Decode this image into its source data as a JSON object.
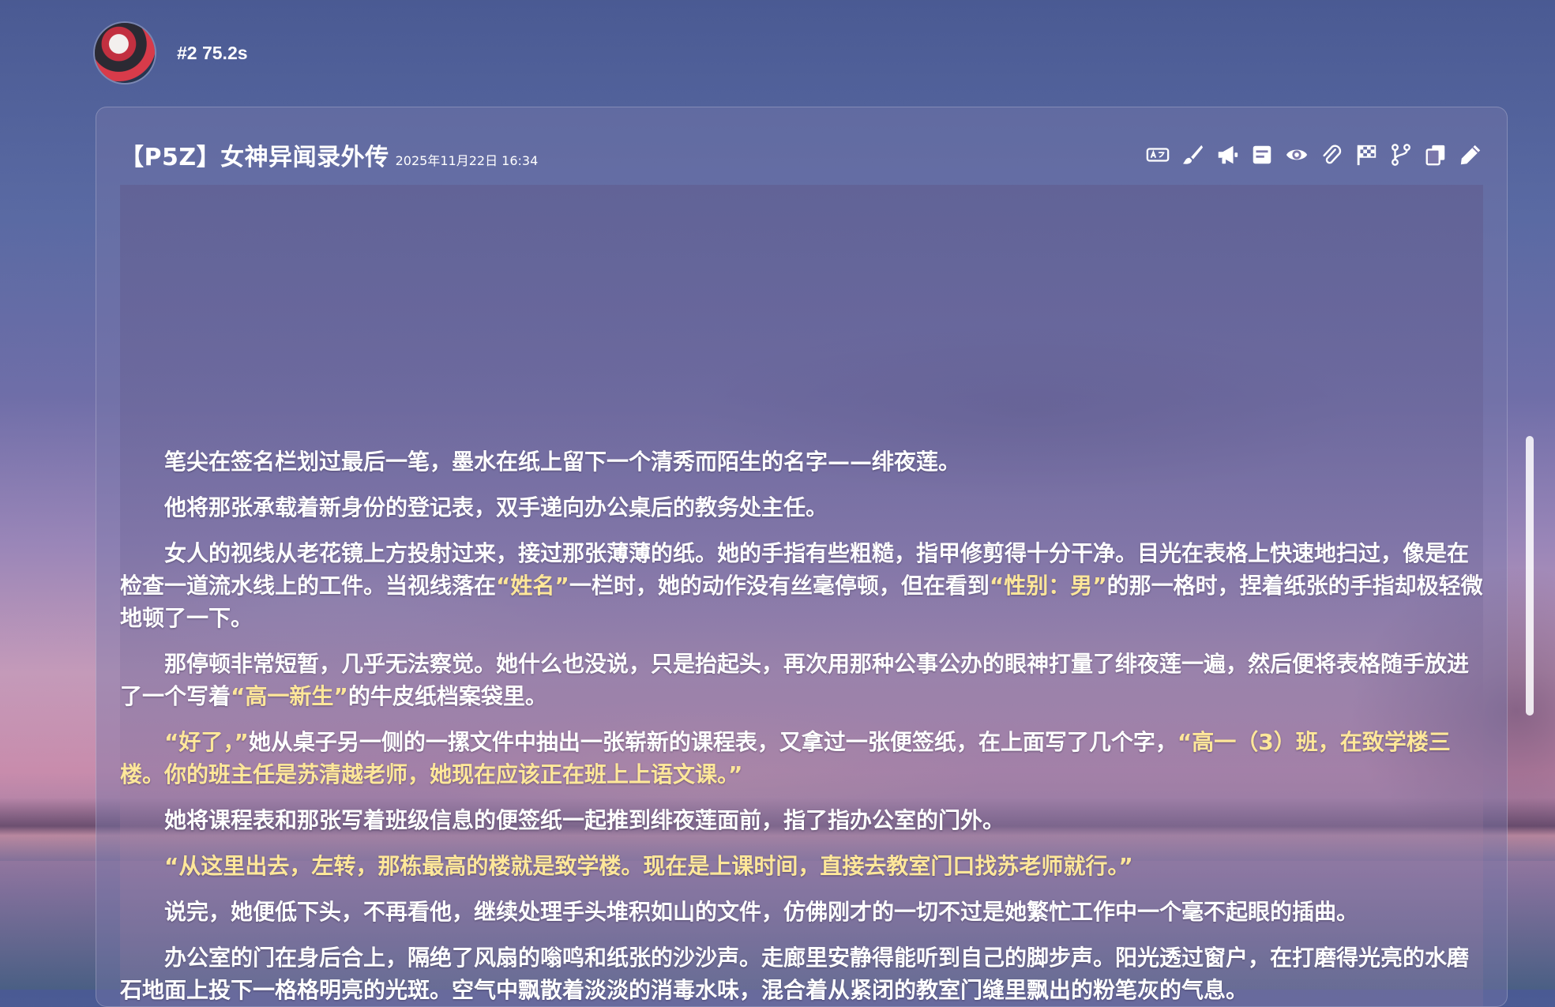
{
  "message": {
    "meta": "#2 75.2s",
    "title": "【P5Z】女神异闻录外传",
    "date": "2025年11月22日 16:34"
  },
  "toolbar": [
    {
      "icon": "translate-icon",
      "label": "translate"
    },
    {
      "icon": "brush-icon",
      "label": "brush"
    },
    {
      "icon": "megaphone-icon",
      "label": "narrate"
    },
    {
      "icon": "note-icon",
      "label": "note"
    },
    {
      "icon": "eye-icon",
      "label": "view"
    },
    {
      "icon": "paperclip-icon",
      "label": "attach"
    },
    {
      "icon": "flag-icon",
      "label": "checkpoint"
    },
    {
      "icon": "branch-icon",
      "label": "branch"
    },
    {
      "icon": "copy-icon",
      "label": "copy"
    },
    {
      "icon": "pencil-icon",
      "label": "edit"
    }
  ],
  "paragraphs": [
    {
      "segments": [
        {
          "t": "笔尖在签名栏划过最后一笔，墨水在纸上留下一个清秀而陌生的名字——绯夜莲。"
        }
      ]
    },
    {
      "segments": [
        {
          "t": "他将那张承载着新身份的登记表，双手递向办公桌后的教务处主任。"
        }
      ]
    },
    {
      "segments": [
        {
          "t": "女人的视线从老花镜上方投射过来，接过那张薄薄的纸。她的手指有些粗糙，指甲修剪得十分干净。目光在表格上快速地扫过，像是在检查一道流水线上的工件。当视线落在"
        },
        {
          "t": "“姓名”",
          "hl": true
        },
        {
          "t": "一栏时，她的动作没有丝毫停顿，但在看到"
        },
        {
          "t": "“性别：男”",
          "hl": true
        },
        {
          "t": "的那一格时，捏着纸张的手指却极轻微地顿了一下。"
        }
      ]
    },
    {
      "segments": [
        {
          "t": "那停顿非常短暂，几乎无法察觉。她什么也没说，只是抬起头，再次用那种公事公办的眼神打量了绯夜莲一遍，然后便将表格随手放进了一个写着"
        },
        {
          "t": "“高一新生”",
          "hl": true
        },
        {
          "t": "的牛皮纸档案袋里。"
        }
      ]
    },
    {
      "segments": [
        {
          "t": "“好了，”",
          "hl": true
        },
        {
          "t": "她从桌子另一侧的一摞文件中抽出一张崭新的课程表，又拿过一张便签纸，在上面写了几个字，"
        },
        {
          "t": "“高一（3）班，在致学楼三楼。你的班主任是苏清越老师，她现在应该正在班上上语文课。”",
          "hl": true
        }
      ]
    },
    {
      "segments": [
        {
          "t": "她将课程表和那张写着班级信息的便签纸一起推到绯夜莲面前，指了指办公室的门外。"
        }
      ]
    },
    {
      "segments": [
        {
          "t": "“从这里出去，左转，那栋最高的楼就是致学楼。现在是上课时间，直接去教室门口找苏老师就行。”",
          "hl": true
        }
      ]
    },
    {
      "segments": [
        {
          "t": "说完，她便低下头，不再看他，继续处理手头堆积如山的文件，仿佛刚才的一切不过是她繁忙工作中一个毫不起眼的插曲。"
        }
      ]
    },
    {
      "segments": [
        {
          "t": "办公室的门在身后合上，隔绝了风扇的嗡鸣和纸张的沙沙声。走廊里安静得能听到自己的脚步声。阳光透过窗户，在打磨得光亮的水磨石地面上投下一格格明亮的光斑。空气中飘散着淡淡的消毒水味，混合着从紧闭的教室门缝里飘出的粉笔灰的气息。"
        }
      ]
    }
  ]
}
